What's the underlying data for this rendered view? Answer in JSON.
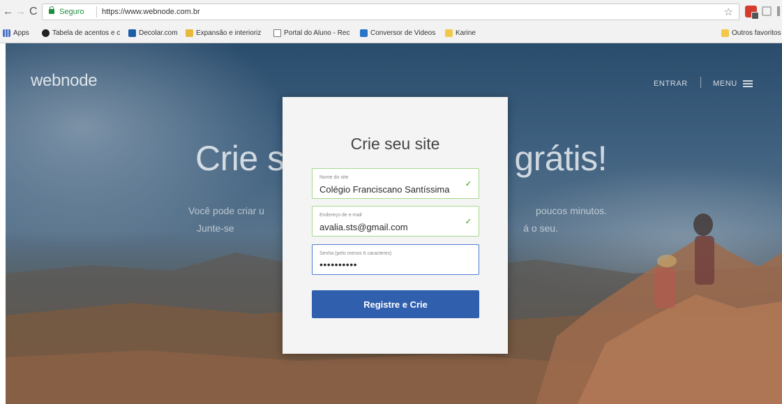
{
  "browser": {
    "secure_label": "Seguro",
    "url": "https://www.webnode.com.br",
    "bookmarks": [
      {
        "label": "Apps",
        "icon": "apps-grid-icon"
      },
      {
        "label": "Tabela de acentos e c",
        "icon": "globe-icon"
      },
      {
        "label": "Decolar.com",
        "icon": "site-icon"
      },
      {
        "label": "Expansão e interioriz",
        "icon": "folder-icon"
      },
      {
        "label": "Portal do Aluno - Rec",
        "icon": "page-icon"
      },
      {
        "label": "Conversor de Videos",
        "icon": "converter-icon"
      },
      {
        "label": "Karine",
        "icon": "folder-icon"
      }
    ],
    "other_bookmarks": "Outros favoritos"
  },
  "site": {
    "brand": "webnode",
    "nav_login": "ENTRAR",
    "nav_menu": "MENU"
  },
  "hero": {
    "title_left": "Crie se",
    "title_right": "grátis!",
    "subtitle_1_left": "Você pode criar u",
    "subtitle_1_right": "poucos minutos.",
    "subtitle_2_left": "Junte-se",
    "subtitle_2_right": "á o seu."
  },
  "signup": {
    "title": "Crie seu site",
    "site_name_label": "Nome do site",
    "site_name_value": "Colégio Franciscano Santíssima",
    "email_label": "Endereço de e-mail",
    "email_value": "avalia.sts@gmail.com",
    "password_label": "Senha (pelo menos 6 caracteres)",
    "password_value": "••••••••••",
    "submit_label": "Registre e Crie"
  },
  "colors": {
    "submit_bg": "#2f5fad",
    "valid_border": "#a6d88f",
    "focus_border": "#4c7bd2",
    "secure_green": "#1e8e3e"
  }
}
